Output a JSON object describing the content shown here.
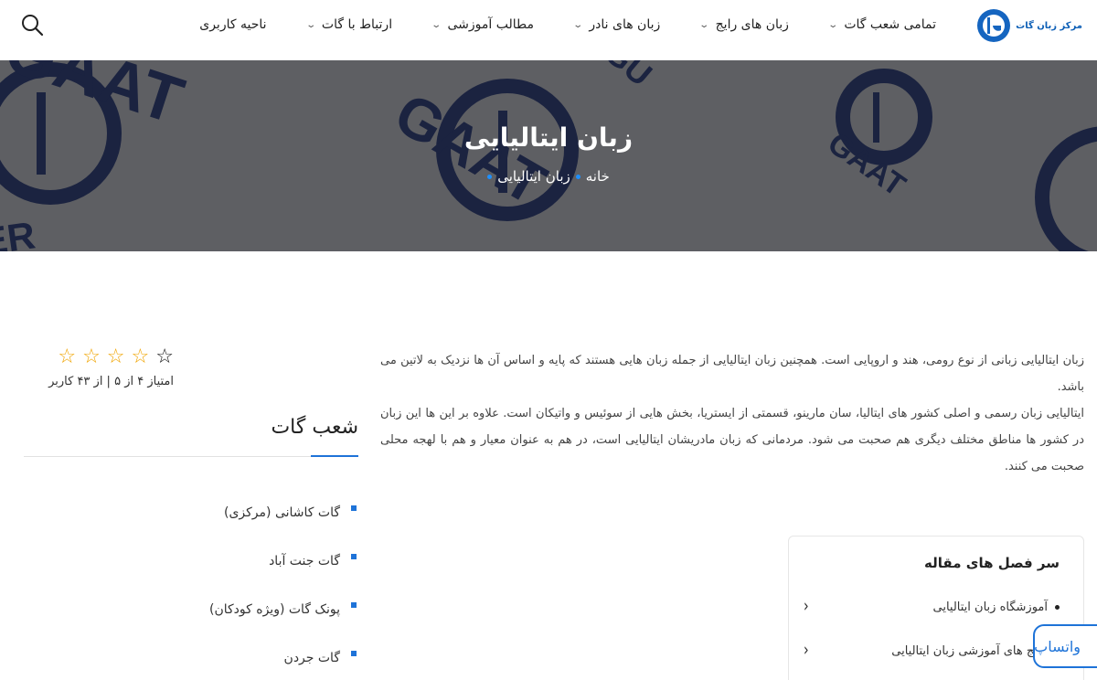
{
  "header": {
    "logo_text": "مرکز زبان گات",
    "nav": [
      {
        "label": "تمامی شعب گات",
        "has_dropdown": true
      },
      {
        "label": "زبان های رایج",
        "has_dropdown": true
      },
      {
        "label": "زبان های نادر",
        "has_dropdown": true
      },
      {
        "label": "مطالب آموزشی",
        "has_dropdown": true
      },
      {
        "label": "ارتباط با گات",
        "has_dropdown": true
      },
      {
        "label": "ناحیه کاربری",
        "has_dropdown": false
      }
    ],
    "search_icon": "search-icon"
  },
  "hero": {
    "title": "زبان ایتالیایی",
    "breadcrumb": [
      "خانه",
      "زبان ایتالیایی"
    ],
    "watermark_texts": [
      "GAAT",
      "LANGUAGE CENTER",
      "GAAT LANGU",
      "GAAT",
      "GAAT"
    ]
  },
  "article": {
    "paragraph_1": "زبان ایتالیایی زبانی از نوع رومی، هند و اروپایی است. همچنین زبان ایتالیایی از جمله زبان هایی هستند که پایه و اساس آن ها نزدیک به لاتین می باشد.",
    "paragraph_2": "ایتالیایی زبان رسمی و اصلی کشور های ایتالیا، سان مارینو، قسمتی از ایستریا، بخش هایی از سوئیس و واتیکان است. علاوه بر این ها این زبان در کشور ها مناطق مختلف دیگری هم صحبت می شود. مردمانی که زبان مادریشان ایتالیایی است، در هم به عنوان معیار و هم با لهجه محلی صحبت می کنند."
  },
  "toc": {
    "title": "سر فصل های مقاله",
    "items": [
      {
        "label": "آموزشگاه زبان ایتالیایی"
      },
      {
        "label": "پکیج های آموزشی زبان ایتالیایی"
      }
    ]
  },
  "floating_button": {
    "label": "واتساپ"
  },
  "rating": {
    "stars_filled": 4,
    "stars_total": 5,
    "text": "امتیاز ۴ از ۵ | از ۴۳ کاربر"
  },
  "sidebar": {
    "title": "شعب گات",
    "branches": [
      "گات کاشانی (مرکزی)",
      "گات جنت آباد",
      "پونک گات (ویژه کودکان)",
      "گات جردن"
    ]
  },
  "colors": {
    "accent": "#1e73d8",
    "star": "#f0a400",
    "hero_overlay": "#5c5d61"
  }
}
